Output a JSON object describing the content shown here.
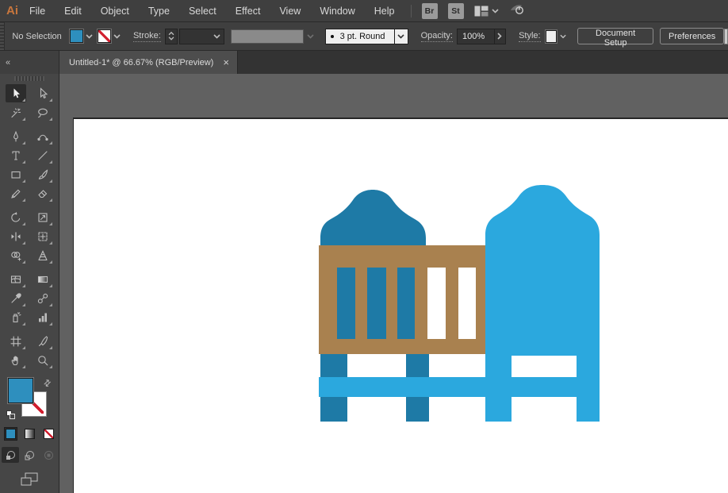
{
  "menubar": {
    "logo": "Ai",
    "items": [
      "File",
      "Edit",
      "Object",
      "Type",
      "Select",
      "Effect",
      "View",
      "Window",
      "Help"
    ],
    "bridge_label": "Br",
    "stock_label": "St"
  },
  "controlbar": {
    "selection_status": "No Selection",
    "stroke_label": "Stroke:",
    "brush_value": "3 pt. Round",
    "opacity_label": "Opacity:",
    "opacity_value": "100%",
    "style_label": "Style:",
    "document_setup_label": "Document Setup",
    "preferences_label": "Preferences"
  },
  "tabbar": {
    "title": "Untitled-1* @ 66.67% (RGB/Preview)",
    "close_label": "×",
    "zoom_level": "66.67%",
    "document_name": "Untitled-1",
    "color_mode": "RGB/Preview"
  },
  "toolbar": {
    "collapse_glyph": "«",
    "groups": [
      [
        {
          "id": "selection",
          "label": "Selection Tool",
          "selected": true
        },
        {
          "id": "direct-selection",
          "label": "Direct Selection Tool"
        },
        {
          "id": "magic-wand",
          "label": "Magic Wand Tool"
        },
        {
          "id": "lasso",
          "label": "Lasso Tool"
        }
      ],
      [
        {
          "id": "pen",
          "label": "Pen Tool"
        },
        {
          "id": "curvature",
          "label": "Curvature Tool"
        },
        {
          "id": "type",
          "label": "Type Tool"
        },
        {
          "id": "line-segment",
          "label": "Line Segment Tool"
        },
        {
          "id": "rectangle",
          "label": "Rectangle Tool"
        },
        {
          "id": "paintbrush",
          "label": "Paintbrush Tool"
        },
        {
          "id": "pencil",
          "label": "Pencil Tool"
        },
        {
          "id": "eraser",
          "label": "Eraser Tool"
        }
      ],
      [
        {
          "id": "rotate",
          "label": "Rotate Tool"
        },
        {
          "id": "scale",
          "label": "Scale Tool"
        },
        {
          "id": "width",
          "label": "Width Tool"
        },
        {
          "id": "free-transform",
          "label": "Free Transform Tool"
        },
        {
          "id": "shape-builder",
          "label": "Shape Builder Tool"
        },
        {
          "id": "perspective-grid",
          "label": "Perspective Grid Tool"
        }
      ],
      [
        {
          "id": "mesh",
          "label": "Mesh Tool"
        },
        {
          "id": "gradient",
          "label": "Gradient Tool"
        },
        {
          "id": "eyedropper",
          "label": "Eyedropper Tool"
        },
        {
          "id": "blend",
          "label": "Blend Tool"
        },
        {
          "id": "symbol-sprayer",
          "label": "Symbol Sprayer Tool"
        },
        {
          "id": "column-graph",
          "label": "Column Graph Tool"
        }
      ],
      [
        {
          "id": "artboard",
          "label": "Artboard Tool"
        },
        {
          "id": "slice",
          "label": "Slice Tool"
        },
        {
          "id": "hand",
          "label": "Hand Tool"
        },
        {
          "id": "zoom",
          "label": "Zoom Tool"
        }
      ]
    ],
    "swap_glyph": "⇄"
  },
  "artwork": {
    "subject": "baby crib flat icon",
    "colors": {
      "dark_blue": "#1e7aa6",
      "light_blue": "#2ba8de",
      "brown": "#a9814f",
      "background": "#ffffff"
    },
    "rail_slots": {
      "blue": 3,
      "white": 2
    }
  },
  "colors": {
    "ui_fill_swatch": "#2e8fbe",
    "none_slash_red": "#d11f2f",
    "pasteboard_gray": "#616161",
    "chrome_gray": "#3f3f3f",
    "logo_orange": "#c8763d"
  }
}
